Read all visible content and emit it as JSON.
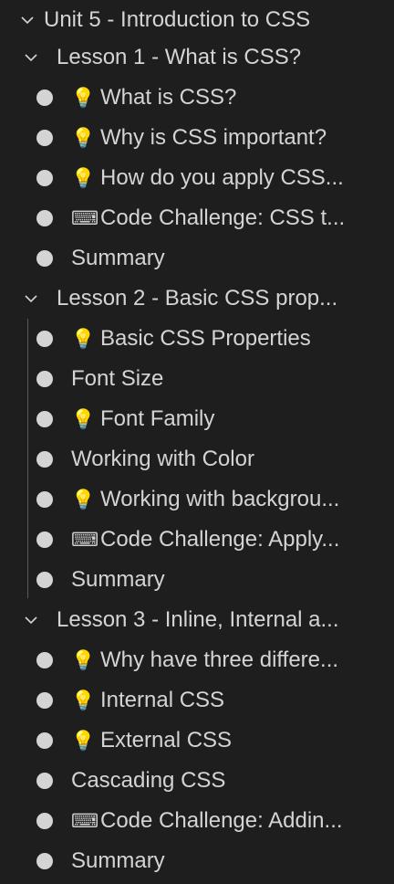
{
  "tree": {
    "unit": {
      "title": "Unit 5 - Introduction to CSS",
      "expanded": true
    },
    "lessons": [
      {
        "title": "Lesson 1 - What is CSS?",
        "items": [
          {
            "icon": "lightbulb",
            "glyph": "💡",
            "label": "What is CSS?"
          },
          {
            "icon": "lightbulb",
            "glyph": "💡",
            "label": "Why is CSS important?"
          },
          {
            "icon": "lightbulb",
            "glyph": "💡",
            "label": "How do you apply CSS..."
          },
          {
            "icon": "keyboard",
            "glyph": "⌨",
            "label": "Code Challenge: CSS t..."
          },
          {
            "icon": "none",
            "glyph": "",
            "label": "Summary"
          }
        ]
      },
      {
        "title": "Lesson 2 - Basic CSS prop...",
        "items": [
          {
            "icon": "lightbulb",
            "glyph": "💡",
            "label": "Basic CSS Properties"
          },
          {
            "icon": "none",
            "glyph": "",
            "label": "Font Size"
          },
          {
            "icon": "lightbulb",
            "glyph": "💡",
            "label": "Font Family"
          },
          {
            "icon": "none",
            "glyph": "",
            "label": "Working with Color"
          },
          {
            "icon": "lightbulb",
            "glyph": "💡",
            "label": "Working with backgrou..."
          },
          {
            "icon": "keyboard",
            "glyph": "⌨",
            "label": "Code Challenge: Apply..."
          },
          {
            "icon": "none",
            "glyph": "",
            "label": "Summary"
          }
        ]
      },
      {
        "title": "Lesson 3 - Inline, Internal a...",
        "items": [
          {
            "icon": "lightbulb",
            "glyph": "💡",
            "label": "Why have three differe..."
          },
          {
            "icon": "lightbulb",
            "glyph": "💡",
            "label": "Internal CSS"
          },
          {
            "icon": "lightbulb",
            "glyph": "💡",
            "label": "External CSS"
          },
          {
            "icon": "none",
            "glyph": "",
            "label": "Cascading CSS"
          },
          {
            "icon": "keyboard",
            "glyph": "⌨",
            "label": "Code Challenge: Addin..."
          },
          {
            "icon": "none",
            "glyph": "",
            "label": "Summary"
          }
        ]
      }
    ]
  },
  "colors": {
    "background": "#1e1e1e",
    "text": "#d4d4d4",
    "bullet": "#d4d4d4",
    "indent_guide": "#5a5a5a"
  }
}
